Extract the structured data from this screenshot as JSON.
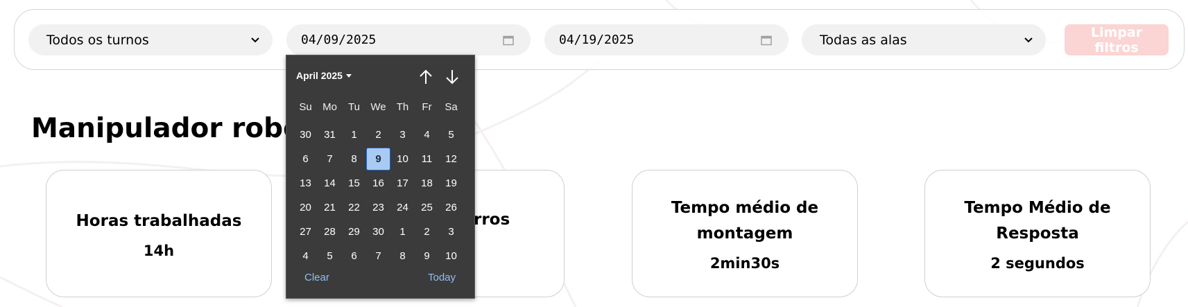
{
  "filters": {
    "shift_select": {
      "value": "Todos os turnos"
    },
    "start_date": {
      "value": "04/09/2025"
    },
    "end_date": {
      "value": "04/19/2025"
    },
    "wing_select": {
      "value": "Todas as alas"
    },
    "clear_button": {
      "label": "Limpar filtros"
    }
  },
  "page_title": "Manipulador robótico",
  "cards": [
    {
      "title": "Horas trabalhadas",
      "value": "14h"
    },
    {
      "title": "rros",
      "value": ""
    },
    {
      "title": "Tempo médio de montagem",
      "value": "2min30s"
    },
    {
      "title": "Tempo Médio de Resposta",
      "value": "2 segundos"
    }
  ],
  "datepicker": {
    "month_label": "April 2025",
    "weekdays": [
      "Su",
      "Mo",
      "Tu",
      "We",
      "Th",
      "Fr",
      "Sa"
    ],
    "days": [
      "30",
      "31",
      "1",
      "2",
      "3",
      "4",
      "5",
      "6",
      "7",
      "8",
      "9",
      "10",
      "11",
      "12",
      "13",
      "14",
      "15",
      "16",
      "17",
      "18",
      "19",
      "20",
      "21",
      "22",
      "23",
      "24",
      "25",
      "26",
      "27",
      "28",
      "29",
      "30",
      "1",
      "2",
      "3",
      "4",
      "5",
      "6",
      "7",
      "8",
      "9",
      "10"
    ],
    "selected_day": "9",
    "clear_label": "Clear",
    "today_label": "Today"
  },
  "colors": {
    "clear_button_bg": "#fbd4d4",
    "picker_bg": "#3b3b3b",
    "selected_day_bg": "#a9cbf3",
    "link": "#8fbff5"
  }
}
